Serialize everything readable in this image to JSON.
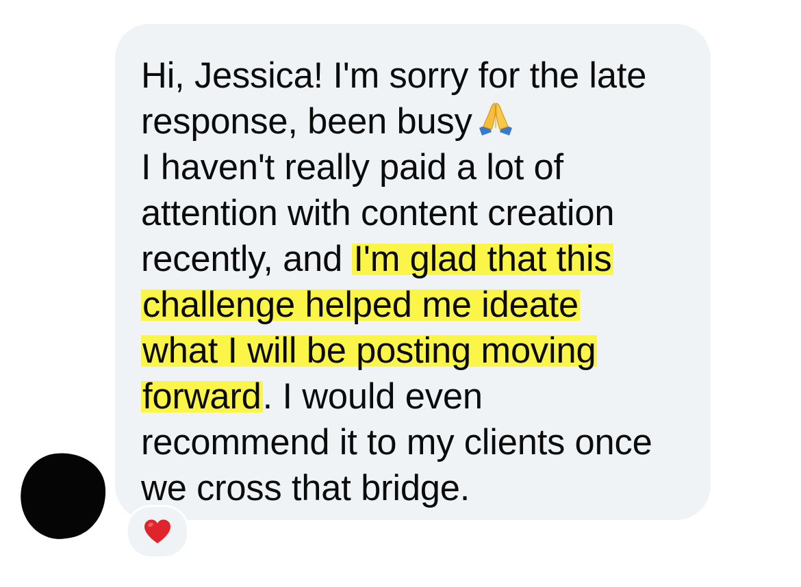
{
  "sender": {
    "avatar": "redacted-avatar"
  },
  "message": {
    "lines": [
      {
        "text": "Hi, Jessica! I'm sorry for the late"
      },
      {
        "text": "response, been busy",
        "emoji": "pray-icon"
      },
      {
        "text": "I haven't really paid a lot of"
      },
      {
        "text": "attention with content creation"
      },
      {
        "before": "recently, and ",
        "highlight": "I'm glad that this"
      },
      {
        "highlight": "challenge helped me ideate"
      },
      {
        "highlight": "what I will be posting moving"
      },
      {
        "highlight": "forward",
        "after": ". I would even"
      },
      {
        "text": "recommend it to my clients once"
      },
      {
        "text": "we cross that bridge."
      }
    ],
    "highlight_color": "#fbf449",
    "bubble_color": "#eff3f5"
  },
  "reaction": {
    "icon": "heart-icon",
    "color": "#e0242c"
  }
}
